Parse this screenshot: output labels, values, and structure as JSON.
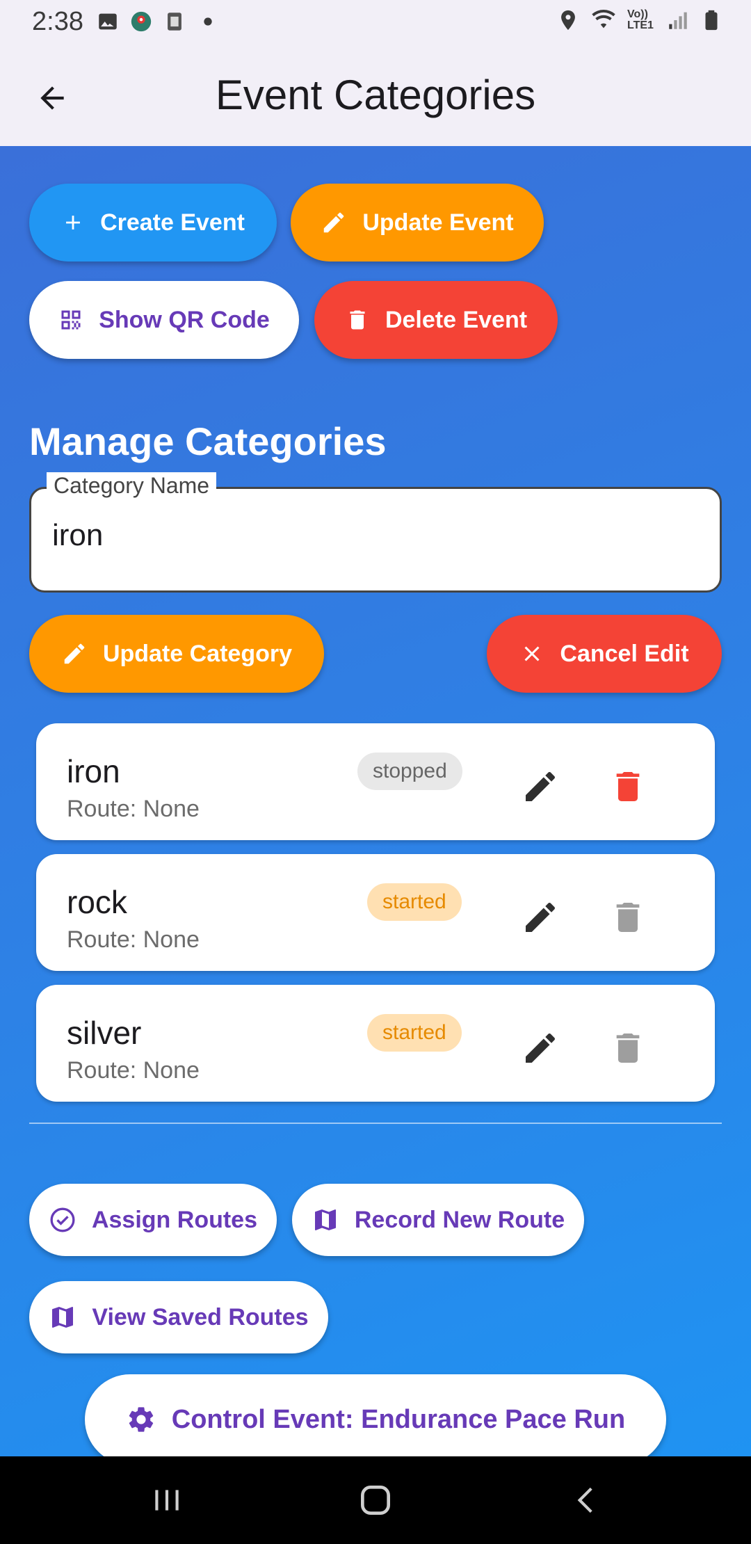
{
  "status_bar": {
    "time": "2:38",
    "icons_left": [
      "image-icon",
      "map-pin-app-icon",
      "k-app-icon",
      "dot-icon"
    ],
    "icons_right": [
      "location-icon",
      "wifi-icon",
      "volte-icon",
      "signal-icon",
      "battery-icon"
    ],
    "volte_text": "Vo)) LTE1"
  },
  "app_bar": {
    "title": "Event Categories"
  },
  "event_actions": {
    "create": "Create Event",
    "update": "Update Event",
    "show_qr": "Show QR Code",
    "delete": "Delete Event"
  },
  "manage": {
    "title": "Manage Categories",
    "field_label": "Category Name",
    "field_value": "iron",
    "update_button": "Update Category",
    "cancel_button": "Cancel Edit"
  },
  "categories": [
    {
      "name": "iron",
      "route": "Route: None",
      "status": "stopped"
    },
    {
      "name": "rock",
      "route": "Route: None",
      "status": "started"
    },
    {
      "name": "silver",
      "route": "Route: None",
      "status": "started"
    }
  ],
  "route_actions": {
    "assign": "Assign Routes",
    "record": "Record New Route",
    "view": "View Saved Routes",
    "control": "Control Event: Endurance Pace Run"
  },
  "colors": {
    "blue": "#2196f3",
    "orange": "#ff9800",
    "red": "#f44336",
    "purple": "#673ab7"
  }
}
